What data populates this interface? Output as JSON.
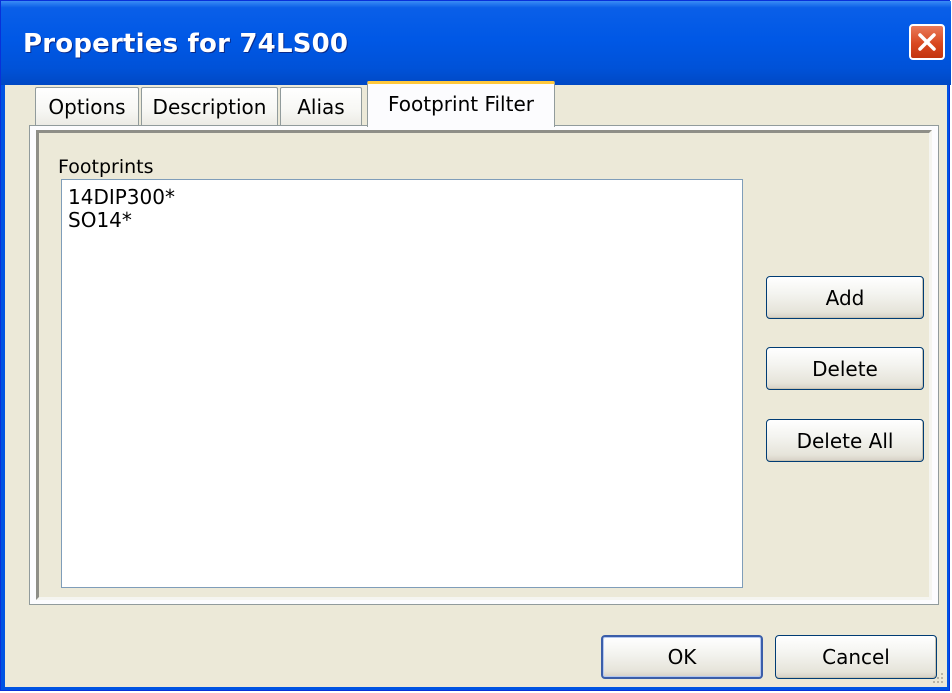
{
  "window": {
    "title": "Properties for 74LS00"
  },
  "tabs": [
    {
      "label": "Options",
      "active": false
    },
    {
      "label": "Description",
      "active": false
    },
    {
      "label": "Alias",
      "active": false
    },
    {
      "label": "Footprint Filter",
      "active": true
    }
  ],
  "footprints": {
    "label": "Footprints",
    "items": [
      "14DIP300*",
      "SO14*"
    ]
  },
  "side_buttons": {
    "add": "Add",
    "delete": "Delete",
    "delete_all": "Delete All"
  },
  "dialog_buttons": {
    "ok": "OK",
    "cancel": "Cancel"
  },
  "colors": {
    "titlebar": "#0058e6",
    "client_bg": "#ece9d8",
    "active_tab_highlight": "#ffc83c",
    "close_button": "#d9481f"
  }
}
